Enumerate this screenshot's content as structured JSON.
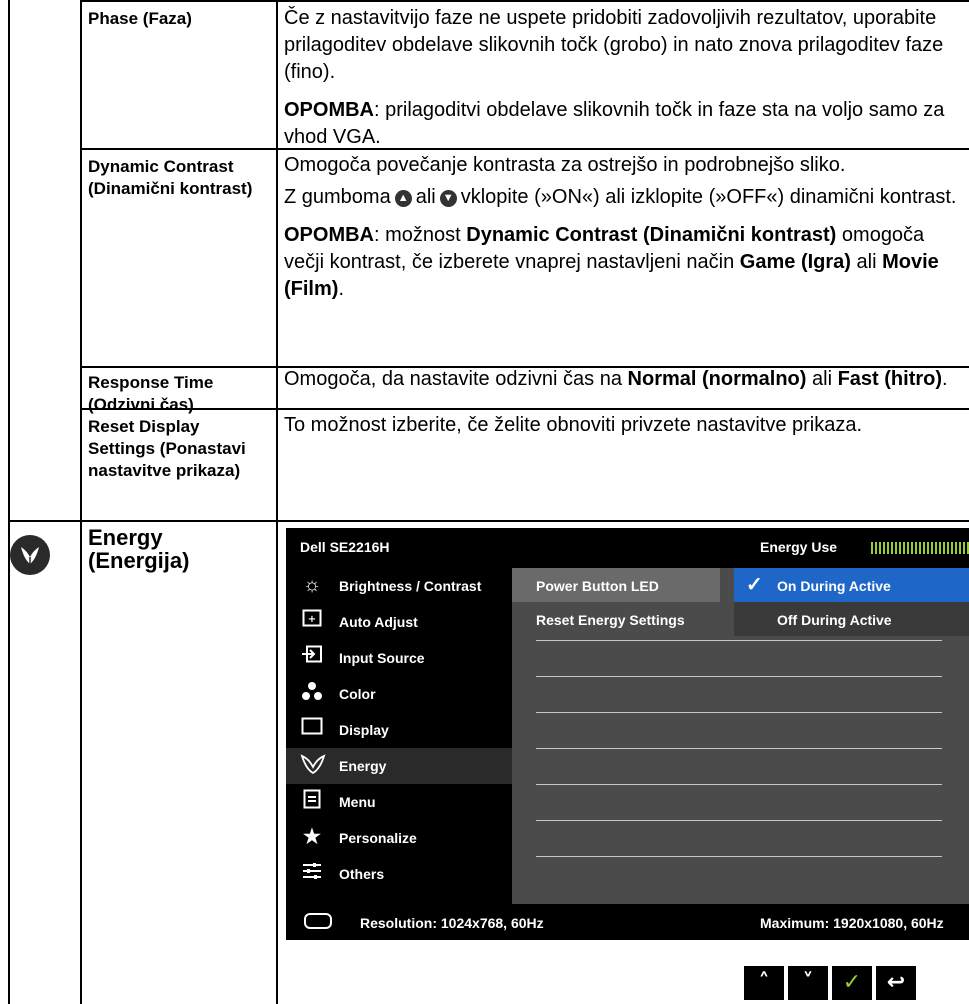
{
  "rows": [
    {
      "label": "Phase (Faza)",
      "paragraphs": [
        "Če z nastavitvijo faze ne uspete pridobiti zadovoljivih rezultatov, uporabite prilagoditev obdelave slikovnih točk (grobo) in nato znova prilagoditev faze (fino).",
        "prilagoditvi obdelave slikovnih točk in faze sta na voljo samo za vhod VGA."
      ],
      "note_label": "OPOMBA"
    },
    {
      "label": "Dynamic Contrast (Dinamični kontrast)",
      "p1": "Omogoča povečanje kontrasta za ostrejšo in podrobnejšo sliko.",
      "p2_a": "Z gumboma",
      "p2_b": "ali",
      "p2_c": "vklopite (»ON«) ali izklopite (»OFF«) dinamični kontrast.",
      "note_label": "OPOMBA",
      "note_a": ": možnost",
      "note_b": "Dynamic Contrast (Dinamični kontrast)",
      "note_c": "omogoča večji kontrast, če izberete vnaprej nastavljeni način",
      "note_d": "Game (Igra)",
      "note_e": "ali",
      "note_f": "Movie (Film)",
      "note_g": "."
    },
    {
      "label": "Response Time (Odzivni čas)",
      "a": "Omogoča, da nastavite odzivni čas na",
      "b": "Normal (normalno)",
      "c": "ali",
      "d": "Fast (hitro)",
      "e": "."
    },
    {
      "label": "Reset Display Settings (Ponastavi nastavitve prikaza)",
      "text": "To možnost izberite, če želite obnoviti privzete nastavitve prikaza."
    },
    {
      "label": "Energy (Energija)"
    }
  ],
  "osd": {
    "title": "Dell SE2216H",
    "energy_use_label": "Energy Use",
    "energy_meter_icon": "energy-meter-bars",
    "menu": [
      {
        "label": "Brightness / Contrast",
        "icon": "brightness-icon"
      },
      {
        "label": "Auto Adjust",
        "icon": "auto-adjust-icon"
      },
      {
        "label": "Input Source",
        "icon": "input-source-icon"
      },
      {
        "label": "Color",
        "icon": "color-icon"
      },
      {
        "label": "Display",
        "icon": "display-icon"
      },
      {
        "label": "Energy",
        "icon": "energy-icon",
        "active": true
      },
      {
        "label": "Menu",
        "icon": "menu-icon"
      },
      {
        "label": "Personalize",
        "icon": "star-icon"
      },
      {
        "label": "Others",
        "icon": "others-icon"
      }
    ],
    "submenu": [
      "Power Button LED",
      "Reset Energy Settings"
    ],
    "options": [
      "On During Active",
      "Off During Active"
    ],
    "resolution": "Resolution: 1024x768, 60Hz",
    "maximum": "Maximum: 1920x1080, 60Hz"
  },
  "buttons": [
    {
      "name": "up-button",
      "glyph": "^"
    },
    {
      "name": "down-button",
      "glyph": "v"
    },
    {
      "name": "ok-button",
      "glyph": "✓"
    },
    {
      "name": "back-button",
      "glyph": "↩"
    }
  ]
}
